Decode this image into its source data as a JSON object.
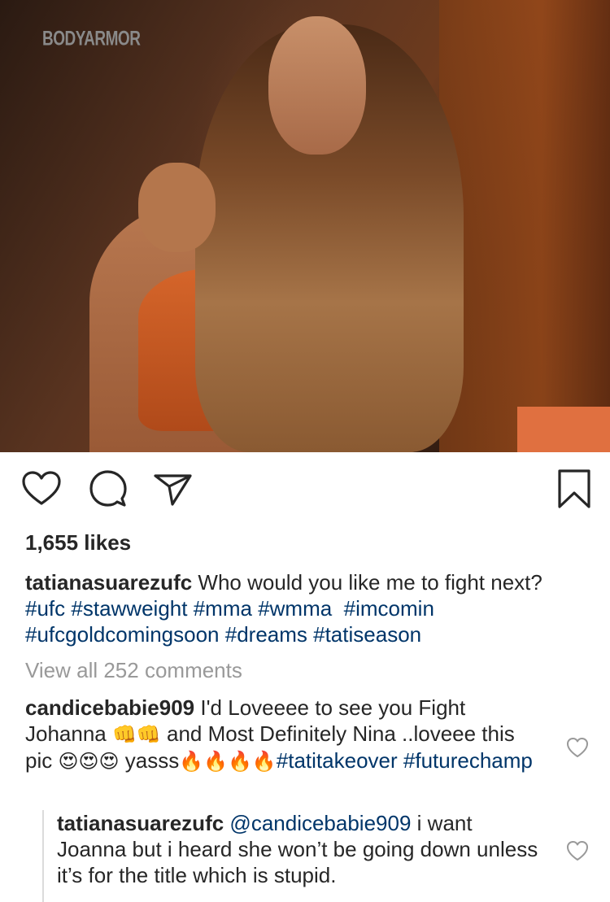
{
  "post": {
    "image_brand_text": "BODYARMOR",
    "likes": "1,655 likes",
    "caption": {
      "username": "tatianasuarezufc",
      "text": "Who would you like me to fight next?",
      "hashtags": [
        "#ufc",
        "#stawweight",
        "#mma",
        "#wmma",
        "#imcomin",
        "#ufcgoldcomingsoon",
        "#dreams",
        "#tatiseason"
      ]
    },
    "view_all_comments": "View all 252 comments"
  },
  "icons": {
    "like": "heart-icon",
    "comment": "comment-icon",
    "share": "send-icon",
    "save": "bookmark-icon"
  },
  "comments": [
    {
      "username": "candicebabie909",
      "text_1": "I'd Loveeee to see you Fight Johanna",
      "emoji_1": "👊👊",
      "text_2": "and Most Definitely  Nina ..loveee this pic",
      "emoji_2": "😍😍😍",
      "text_3": "yasss",
      "emoji_3": "🔥🔥🔥🔥",
      "hashtags": [
        "#tatitakeover",
        "#futurechamp"
      ]
    }
  ],
  "replies": [
    {
      "username": "tatianasuarezufc",
      "mention": "@candicebabie909",
      "text": "i want Joanna but i heard she won’t be going down unless it’s for the title which is stupid."
    }
  ],
  "colors": {
    "text": "#262626",
    "hashtag": "#003569",
    "muted": "#999999"
  }
}
